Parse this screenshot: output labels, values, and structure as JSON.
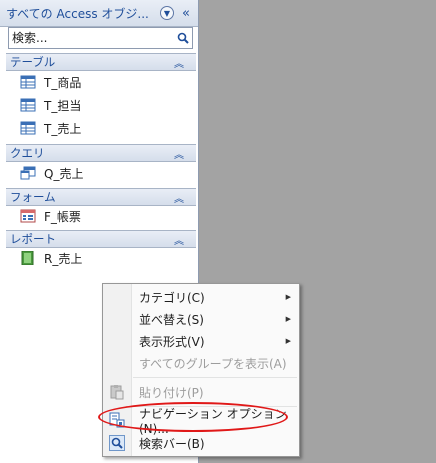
{
  "nav": {
    "title": "すべての Access オブジ...",
    "search_placeholder": "検索...",
    "groups": [
      {
        "label": "テーブル",
        "items": [
          "T_商品",
          "T_担当",
          "T_売上"
        ]
      },
      {
        "label": "クエリ",
        "items": [
          "Q_売上"
        ]
      },
      {
        "label": "フォーム",
        "items": [
          "F_帳票"
        ]
      },
      {
        "label": "レポート",
        "items": [
          "R_売上"
        ]
      }
    ]
  },
  "menu": {
    "items": [
      {
        "label": "カテゴリ(C)",
        "submenu": true,
        "enabled": true
      },
      {
        "label": "並べ替え(S)",
        "submenu": true,
        "enabled": true
      },
      {
        "label": "表示形式(V)",
        "submenu": true,
        "enabled": true
      },
      {
        "label": "すべてのグループを表示(A)",
        "submenu": false,
        "enabled": false
      },
      {
        "label": "貼り付け(P)",
        "submenu": false,
        "enabled": false,
        "icon": "paste-icon"
      },
      {
        "label": "ナビゲーション オプション(N)...",
        "submenu": false,
        "enabled": true,
        "icon": "navigation-options-icon",
        "highlighted": true
      },
      {
        "label": "検索バー(B)",
        "submenu": false,
        "enabled": true,
        "icon": "search-icon"
      }
    ]
  },
  "colors": {
    "accent": "#1f4e9a",
    "highlight_ring": "#e01818"
  }
}
